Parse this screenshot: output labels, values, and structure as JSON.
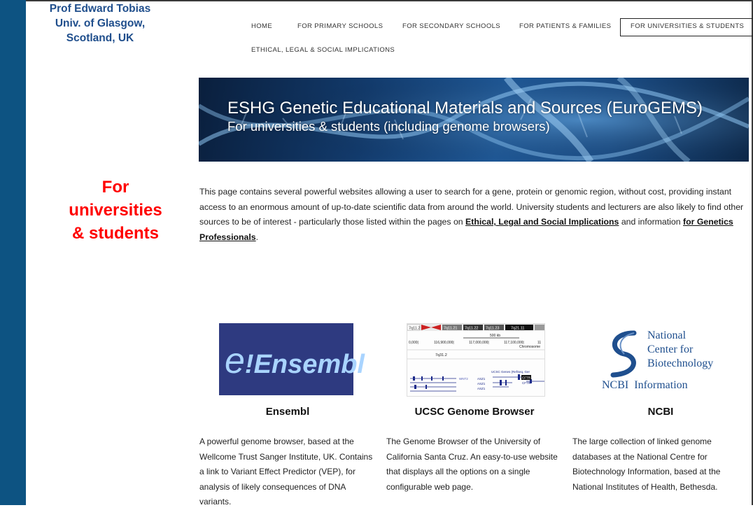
{
  "author": {
    "line1": "Prof Edward Tobias",
    "line2": "Univ. of Glasgow,",
    "line3": "Scotland, UK"
  },
  "side_heading": {
    "line1": "For",
    "line2": "universities",
    "line3": "& students"
  },
  "nav": {
    "items": [
      {
        "label": "HOME"
      },
      {
        "label": "FOR PRIMARY SCHOOLS"
      },
      {
        "label": "FOR SECONDARY SCHOOLS"
      },
      {
        "label": "FOR PATIENTS & FAMILIES"
      },
      {
        "label": "FOR UNIVERSITIES & STUDENTS"
      },
      {
        "label": "ETHICAL, LEGAL & SOCIAL IMPLICATIONS"
      }
    ],
    "active": "FOR UNIVERSITIES & STUDENTS"
  },
  "banner": {
    "title": "ESHG Genetic Educational Materials and Sources (EuroGEMS)",
    "subtitle": "For universities & students (including genome browsers)"
  },
  "intro": {
    "text1": "This page contains several powerful websites allowing a user to search for a gene, protein or genomic region, without cost, providing instant access to an enormous amount of up-to-date scientific data from around the world.  University students and lecturers are also likely to find other sources to be of interest - particularly those listed within the pages on ",
    "link1": "Ethical, Legal and Social Implications",
    "text2": " and information ",
    "link2": "for Genetics Professionals",
    "text3": "."
  },
  "resources": [
    {
      "title": "Ensembl",
      "description": "A powerful genome browser, based at the Wellcome Trust Sanger Institute, UK.  Contains a link to Variant Effect Predictor (VEP), for analysis of likely consequences of DNA variants.",
      "logo_text": "Ensembl",
      "logo_e": "e",
      "logo_bang": "!",
      "icon": "ensembl-logo"
    },
    {
      "title": "UCSC Genome Browser",
      "description": "The Genome Browser of the University of California Santa Cruz. An easy-to-use website that displays all the options on a single configurable web page.",
      "icon": "ucsc-browser-screenshot",
      "screenshot": {
        "bands": [
          "7q11.2",
          "7q11.21",
          "7q11.22",
          "7q11.23",
          "7q21.11"
        ],
        "scale": "500 kb",
        "positions": [
          "0,000|",
          "116,900,000|",
          "117,000,000|",
          "117,100,000|",
          "11"
        ],
        "chrom_label": "Chromosome",
        "band_label": "7q31.2",
        "track_label": "UCSC Genes (RefSeq, Ger",
        "genes": [
          "WNT2",
          "ASZ1",
          "ASZ1",
          "ASZ1",
          "CFTR",
          "CFTR"
        ]
      }
    },
    {
      "title": "NCBI",
      "description": "The large collection of linked genome databases at the National Centre for Biotechnology Information, based at the National Institutes of Health, Bethesda.",
      "icon": "ncbi-logo",
      "logo_lines": [
        "National",
        "Center for",
        "Biotechnology",
        "Information"
      ],
      "logo_acronym": "NCBI"
    }
  ],
  "colors": {
    "sidebar": "#0d5382",
    "author_text": "#1f4e8c",
    "heading_red": "#ff0000",
    "ensembl_bg": "#2e3a80",
    "ncbi_blue": "#1f4f8e"
  }
}
